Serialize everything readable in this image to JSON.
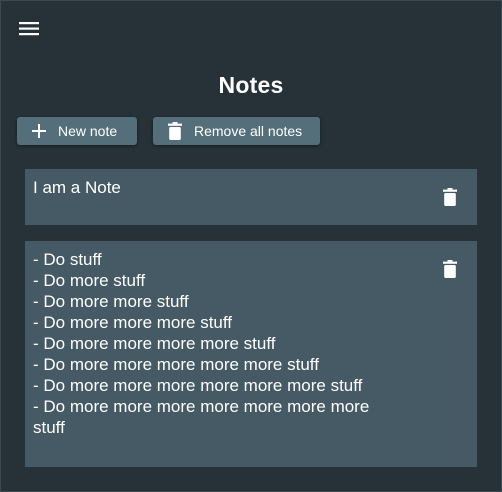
{
  "header": {
    "menu_icon": "hamburger-menu-icon"
  },
  "page": {
    "title": "Notes"
  },
  "toolbar": {
    "new_note_label": "New note",
    "new_note_icon": "plus-icon",
    "remove_all_label": "Remove all notes",
    "remove_all_icon": "trash-icon"
  },
  "notes": [
    {
      "text": "I am a Note",
      "delete_icon": "trash-icon"
    },
    {
      "text": "- Do stuff\n- Do more stuff\n- Do more more stuff\n- Do more more more stuff\n- Do more more more more stuff\n- Do more more more more more stuff\n- Do more more more more more more stuff\n- Do more more more more more more more stuff",
      "delete_icon": "trash-icon"
    }
  ],
  "colors": {
    "background": "#263238",
    "button": "#546e7a",
    "note_card": "#455a64",
    "text": "#ffffff"
  }
}
